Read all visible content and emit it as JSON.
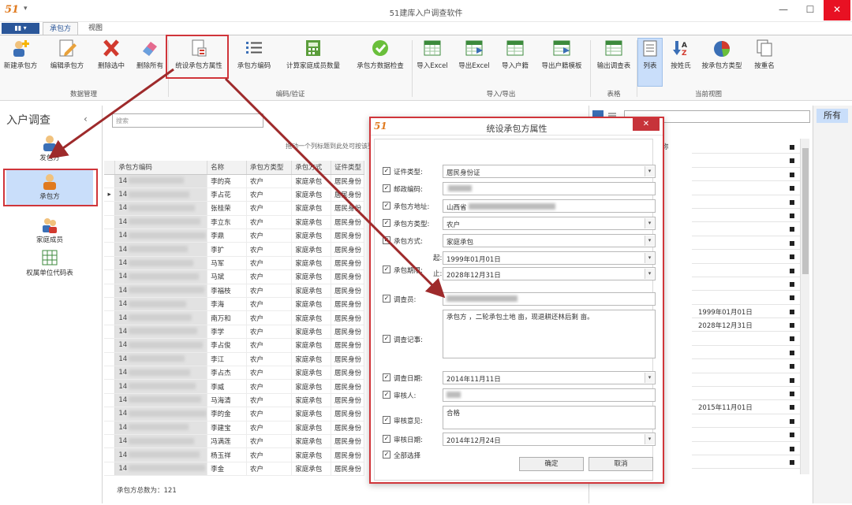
{
  "app": {
    "logo": "51",
    "title": "51建库入户调查软件",
    "controls": {
      "minimize": "—",
      "maximize": "☐",
      "close": "✕"
    }
  },
  "tabs": {
    "file": "▮▮ ▾",
    "items": [
      "承包方",
      "视图"
    ]
  },
  "ribbon": {
    "buttons": [
      {
        "label": "新建承包方",
        "icon": "new-contractor-icon"
      },
      {
        "label": "编辑承包方",
        "icon": "edit-icon"
      },
      {
        "label": "删除选中",
        "icon": "delete-icon"
      },
      {
        "label": "删除所有",
        "icon": "eraser-icon"
      },
      {
        "label": "统设承包方属性",
        "icon": "document-settings-icon"
      },
      {
        "label": "承包方编码",
        "icon": "list-icon"
      },
      {
        "label": "计算家庭成员数量",
        "icon": "calculator-icon"
      },
      {
        "label": "承包方数据检查",
        "icon": "check-icon"
      },
      {
        "label": "导入Excel",
        "icon": "excel-import-icon"
      },
      {
        "label": "导出Excel",
        "icon": "excel-export-icon"
      },
      {
        "label": "导入户籍",
        "icon": "import-household-icon"
      },
      {
        "label": "导出户籍模板",
        "icon": "export-template-icon"
      },
      {
        "label": "输出调查表",
        "icon": "output-form-icon"
      },
      {
        "label": "列表",
        "icon": "list-view-icon"
      },
      {
        "label": "按姓氏",
        "icon": "sort-az-icon"
      },
      {
        "label": "按承包方类型",
        "icon": "pie-icon"
      },
      {
        "label": "按重名",
        "icon": "copy-icon"
      }
    ],
    "groups": [
      "数据管理",
      "编码/验证",
      "导入/导出",
      "表格",
      "当前视图"
    ]
  },
  "leftnav": {
    "title": "入户调查",
    "collapse": "‹",
    "items": [
      "发包方",
      "承包方",
      "家庭成员",
      "权属单位代码表"
    ]
  },
  "main": {
    "search_placeholder": "搜索",
    "group_hint": "拖动一个列标题到此处可按该列分组",
    "columns": [
      "承包方编码",
      "名称",
      "承包方类型",
      "承包方式",
      "证件类型"
    ],
    "rows": [
      {
        "code": "14",
        "name": "李的亮",
        "type": "农户",
        "mode": "家庭承包",
        "id": "居民身份"
      },
      {
        "code": "14",
        "name": "李占花",
        "type": "农户",
        "mode": "家庭承包",
        "id": "居民身份"
      },
      {
        "code": "14",
        "name": "张桂荣",
        "type": "农户",
        "mode": "家庭承包",
        "id": "居民身份"
      },
      {
        "code": "14",
        "name": "李立东",
        "type": "农户",
        "mode": "家庭承包",
        "id": "居民身份"
      },
      {
        "code": "14",
        "name": "李鼎",
        "type": "农户",
        "mode": "家庭承包",
        "id": "居民身份"
      },
      {
        "code": "14",
        "name": "李扩",
        "type": "农户",
        "mode": "家庭承包",
        "id": "居民身份"
      },
      {
        "code": "14",
        "name": "马军",
        "type": "农户",
        "mode": "家庭承包",
        "id": "居民身份"
      },
      {
        "code": "14",
        "name": "马斌",
        "type": "农户",
        "mode": "家庭承包",
        "id": "居民身份"
      },
      {
        "code": "14",
        "name": "李福枝",
        "type": "农户",
        "mode": "家庭承包",
        "id": "居民身份"
      },
      {
        "code": "14",
        "name": "李海",
        "type": "农户",
        "mode": "家庭承包",
        "id": "居民身份"
      },
      {
        "code": "14",
        "name": "南万和",
        "type": "农户",
        "mode": "家庭承包",
        "id": "居民身份"
      },
      {
        "code": "14",
        "name": "李学",
        "type": "农户",
        "mode": "家庭承包",
        "id": "居民身份"
      },
      {
        "code": "14",
        "name": "李占俊",
        "type": "农户",
        "mode": "家庭承包",
        "id": "居民身份"
      },
      {
        "code": "14",
        "name": "李江",
        "type": "农户",
        "mode": "家庭承包",
        "id": "居民身份"
      },
      {
        "code": "14",
        "name": "李占杰",
        "type": "农户",
        "mode": "家庭承包",
        "id": "居民身份"
      },
      {
        "code": "14",
        "name": "李威",
        "type": "农户",
        "mode": "家庭承包",
        "id": "居民身份"
      },
      {
        "code": "14",
        "name": "马海清",
        "type": "农户",
        "mode": "家庭承包",
        "id": "居民身份"
      },
      {
        "code": "14",
        "name": "李的金",
        "type": "农户",
        "mode": "家庭承包",
        "id": "居民身份"
      },
      {
        "code": "14",
        "name": "李建宝",
        "type": "农户",
        "mode": "家庭承包",
        "id": "居民身份"
      },
      {
        "code": "14",
        "name": "冯满莲",
        "type": "农户",
        "mode": "家庭承包",
        "id": "居民身份"
      },
      {
        "code": "14",
        "name": "杨玉祥",
        "type": "农户",
        "mode": "家庭承包",
        "id": "居民身份"
      },
      {
        "code": "14",
        "name": "李金",
        "type": "农户",
        "mode": "家庭承包",
        "id": "居民身份"
      }
    ],
    "row_marker": "▸",
    "footer": "承包方总数为：121"
  },
  "rightpane": {
    "header": "称",
    "values": [
      "1999年01月01日",
      "2028年12月31日",
      "2015年11月01日"
    ]
  },
  "farright": {
    "tab": "所有"
  },
  "dialog": {
    "logo": "51",
    "title": "统设承包方属性",
    "close": "✕",
    "check": "✓",
    "fields": {
      "cert_type": {
        "label": "证件类型:",
        "value": "居民身份证"
      },
      "postcode": {
        "label": "邮政编码:",
        "value": ""
      },
      "address": {
        "label": "承包方地址:",
        "value": "山西省"
      },
      "ctype": {
        "label": "承包方类型:",
        "value": "农户"
      },
      "cmode": {
        "label": "承包方式:",
        "value": "家庭承包"
      },
      "period": {
        "label": "承包期限:",
        "start_label": "起:",
        "start": "1999年01月01日",
        "end_label": "止:",
        "end": "2028年12月31日"
      },
      "surveyor": {
        "label": "调查员:",
        "value": ""
      },
      "survey_note": {
        "label": "调查记事:",
        "value": "承包方      ，二轮承包土地      亩，现退耕还林后剩 亩。"
      },
      "survey_date": {
        "label": "调查日期:",
        "value": "2014年11月11日"
      },
      "reviewer": {
        "label": "审核人:",
        "value": ""
      },
      "review_note": {
        "label": "审核意见:",
        "value": "合格"
      },
      "review_date": {
        "label": "审核日期:",
        "value": "2014年12月24日"
      },
      "select_all": {
        "label": "全部选择"
      }
    },
    "ok": "确定",
    "cancel": "取消"
  }
}
